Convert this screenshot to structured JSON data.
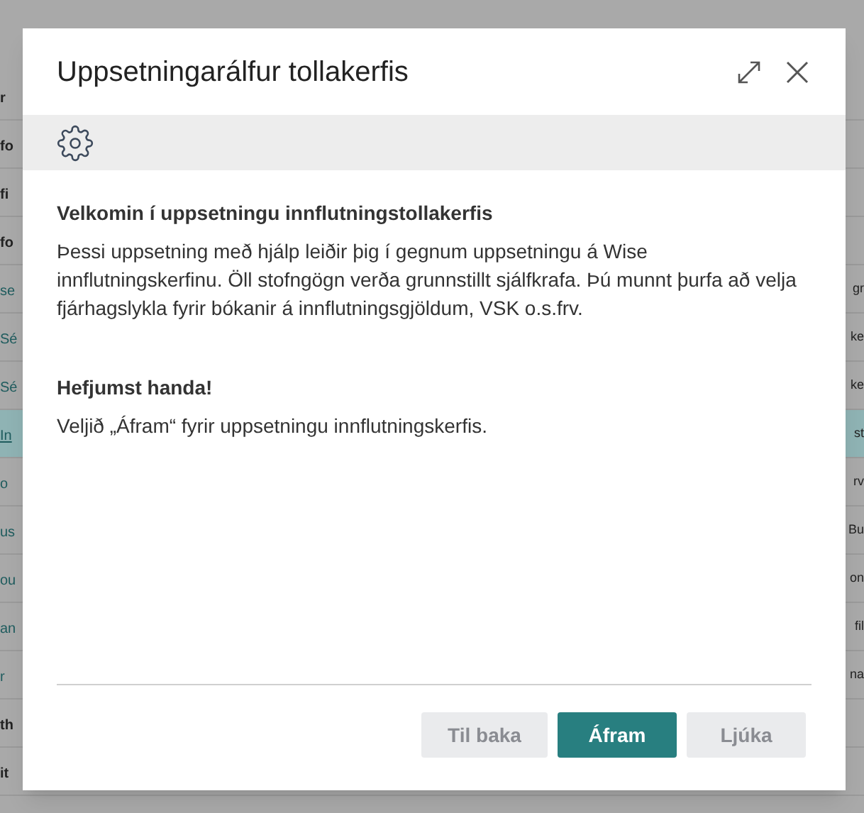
{
  "background_rows": [
    {
      "kind": "bold",
      "text": "r",
      "selected": false
    },
    {
      "kind": "bold",
      "text": "fo",
      "selected": false
    },
    {
      "kind": "bold",
      "text": "fi",
      "selected": false
    },
    {
      "kind": "bold",
      "text": "fo",
      "selected": false
    },
    {
      "kind": "link",
      "text": "se",
      "extra": "gr",
      "selected": false
    },
    {
      "kind": "link",
      "text": "Sé",
      "extra": "ke",
      "selected": false
    },
    {
      "kind": "link",
      "text": "Sé",
      "extra": "ke",
      "selected": false
    },
    {
      "kind": "link",
      "text": "In",
      "extra": "st",
      "selected": true
    },
    {
      "kind": "link",
      "text": "o",
      "extra": "rv",
      "selected": false
    },
    {
      "kind": "link",
      "text": "us",
      "extra": "Bu",
      "selected": false
    },
    {
      "kind": "link",
      "text": "ou",
      "extra": "on",
      "selected": false
    },
    {
      "kind": "link",
      "text": "an",
      "extra": "fil",
      "selected": false
    },
    {
      "kind": "link",
      "text": "r",
      "extra": "na",
      "selected": false
    },
    {
      "kind": "bold",
      "text": "th",
      "selected": false
    },
    {
      "kind": "bold",
      "text": "it",
      "selected": false
    }
  ],
  "dialog": {
    "title": "Uppsetningarálfur tollakerfis",
    "sections": [
      {
        "heading": "Velkomin í uppsetningu innflutningstollakerfis",
        "text": "Þessi uppsetning með hjálp leiðir þig í gegnum uppsetningu á Wise innflutningskerfinu. Öll stofngögn verða grunnstillt sjálfkrafa. Þú munnt þurfa að velja fjárhagslykla fyrir bókanir á innflutningsgjöldum, VSK o.s.frv."
      },
      {
        "heading": "Hefjumst handa!",
        "text": "Veljið „Áfram“ fyrir uppsetningu innflutningskerfis."
      }
    ],
    "buttons": [
      {
        "label": "Til baka",
        "kind": "secondary",
        "disabled": true
      },
      {
        "label": "Áfram",
        "kind": "primary",
        "disabled": false
      },
      {
        "label": "Ljúka",
        "kind": "secondary",
        "disabled": true
      }
    ]
  }
}
